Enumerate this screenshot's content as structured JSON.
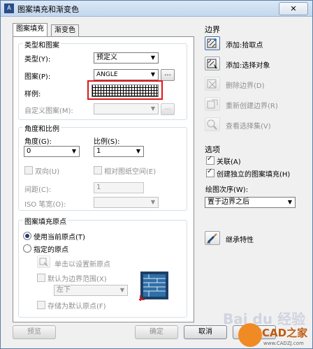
{
  "window": {
    "title": "图案填充和渐变色",
    "close": "✕",
    "app_icon": "A"
  },
  "tabs": [
    {
      "label": "图案填充"
    },
    {
      "label": "渐变色"
    }
  ],
  "type_pattern": {
    "legend": "类型和图案",
    "type_label": "类型(Y):",
    "type_value": "预定义",
    "pattern_label": "图案(P):",
    "pattern_value": "ANGLE",
    "pattern_browse": "...",
    "swatch_label": "样例:",
    "custom_label": "自定义图案(M):",
    "custom_browse": "..."
  },
  "angle_scale": {
    "legend": "角度和比例",
    "angle_label": "角度(G):",
    "angle_value": "0",
    "scale_label": "比例(S):",
    "scale_value": "1",
    "double_label": "双向(U)",
    "relative_label": "相对图纸空间(E)",
    "spacing_label": "间距(C):",
    "spacing_value": "1",
    "iso_label": "ISO 笔宽(O):"
  },
  "origin": {
    "legend": "图案填充原点",
    "current_label": "使用当前原点(T)",
    "specified_label": "指定的原点",
    "click_label": "单击以设置新原点",
    "default_extent_label": "默认为边界范围(X)",
    "extent_value": "左下",
    "store_label": "存储为默认原点(F)"
  },
  "boundaries": {
    "title": "边界",
    "add_pick": "添加:拾取点",
    "add_select": "添加:选择对象",
    "remove": "删除边界(D)",
    "recreate": "重新创建边界(R)",
    "view_sel": "查看选择集(V)"
  },
  "options": {
    "title": "选项",
    "associative": "关联(A)",
    "separate": "创建独立的图案填充(H)",
    "draw_order_label": "绘图次序(W):",
    "draw_order_value": "置于边界之后"
  },
  "inherit": {
    "label": "继承特性"
  },
  "bottom": {
    "preview": "预览",
    "ok": "确定",
    "cancel": "取消",
    "help": "帮助"
  },
  "watermark": {
    "baidu": "Bai du 经验",
    "cad": "CAD之家",
    "site": "www.CADZJ.com"
  }
}
